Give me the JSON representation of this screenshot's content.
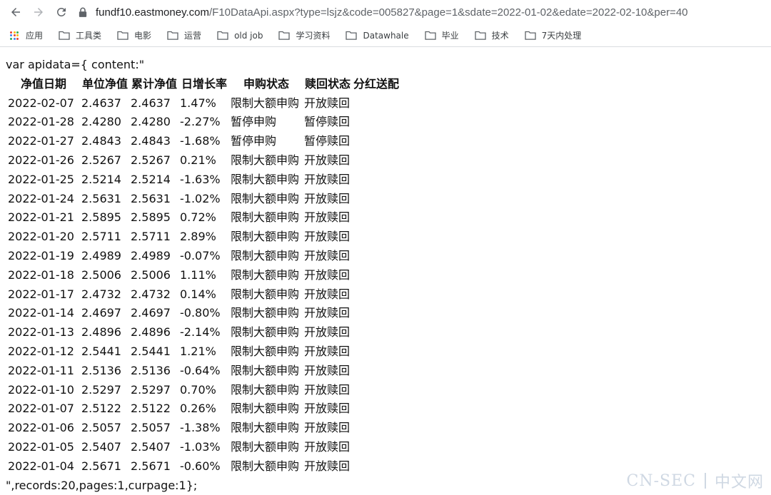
{
  "browser": {
    "url_host": "fundf10.eastmoney.com",
    "url_rest": "/F10DataApi.aspx?type=lsjz&code=005827&page=1&sdate=2022-01-02&edate=2022-02-10&per=40"
  },
  "bookmarks": [
    {
      "label": "应用",
      "icon": "apps-grid-icon"
    },
    {
      "label": "工具类",
      "icon": "folder-icon"
    },
    {
      "label": "电影",
      "icon": "folder-icon"
    },
    {
      "label": "运营",
      "icon": "folder-icon"
    },
    {
      "label": "old job",
      "icon": "folder-icon"
    },
    {
      "label": "学习资料",
      "icon": "folder-icon"
    },
    {
      "label": "Datawhale",
      "icon": "folder-icon"
    },
    {
      "label": "毕业",
      "icon": "folder-icon"
    },
    {
      "label": "技术",
      "icon": "folder-icon"
    },
    {
      "label": "7天内处理",
      "icon": "folder-icon"
    }
  ],
  "content": {
    "prefix": "var apidata={ content:\"",
    "suffix": "\",records:20,pages:1,curpage:1};",
    "headers": [
      "净值日期",
      "单位净值",
      "累计净值",
      "日增长率",
      "申购状态",
      "赎回状态",
      "分红送配"
    ],
    "rows": [
      [
        "2022-02-07",
        "2.4637",
        "2.4637",
        "1.47%",
        "限制大额申购",
        "开放赎回",
        ""
      ],
      [
        "2022-01-28",
        "2.4280",
        "2.4280",
        "-2.27%",
        "暂停申购",
        "暂停赎回",
        ""
      ],
      [
        "2022-01-27",
        "2.4843",
        "2.4843",
        "-1.68%",
        "暂停申购",
        "暂停赎回",
        ""
      ],
      [
        "2022-01-26",
        "2.5267",
        "2.5267",
        "0.21%",
        "限制大额申购",
        "开放赎回",
        ""
      ],
      [
        "2022-01-25",
        "2.5214",
        "2.5214",
        "-1.63%",
        "限制大额申购",
        "开放赎回",
        ""
      ],
      [
        "2022-01-24",
        "2.5631",
        "2.5631",
        "-1.02%",
        "限制大额申购",
        "开放赎回",
        ""
      ],
      [
        "2022-01-21",
        "2.5895",
        "2.5895",
        "0.72%",
        "限制大额申购",
        "开放赎回",
        ""
      ],
      [
        "2022-01-20",
        "2.5711",
        "2.5711",
        "2.89%",
        "限制大额申购",
        "开放赎回",
        ""
      ],
      [
        "2022-01-19",
        "2.4989",
        "2.4989",
        "-0.07%",
        "限制大额申购",
        "开放赎回",
        ""
      ],
      [
        "2022-01-18",
        "2.5006",
        "2.5006",
        "1.11%",
        "限制大额申购",
        "开放赎回",
        ""
      ],
      [
        "2022-01-17",
        "2.4732",
        "2.4732",
        "0.14%",
        "限制大额申购",
        "开放赎回",
        ""
      ],
      [
        "2022-01-14",
        "2.4697",
        "2.4697",
        "-0.80%",
        "限制大额申购",
        "开放赎回",
        ""
      ],
      [
        "2022-01-13",
        "2.4896",
        "2.4896",
        "-2.14%",
        "限制大额申购",
        "开放赎回",
        ""
      ],
      [
        "2022-01-12",
        "2.5441",
        "2.5441",
        "1.21%",
        "限制大额申购",
        "开放赎回",
        ""
      ],
      [
        "2022-01-11",
        "2.5136",
        "2.5136",
        "-0.64%",
        "限制大额申购",
        "开放赎回",
        ""
      ],
      [
        "2022-01-10",
        "2.5297",
        "2.5297",
        "0.70%",
        "限制大额申购",
        "开放赎回",
        ""
      ],
      [
        "2022-01-07",
        "2.5122",
        "2.5122",
        "0.26%",
        "限制大额申购",
        "开放赎回",
        ""
      ],
      [
        "2022-01-06",
        "2.5057",
        "2.5057",
        "-1.38%",
        "限制大额申购",
        "开放赎回",
        ""
      ],
      [
        "2022-01-05",
        "2.5407",
        "2.5407",
        "-1.03%",
        "限制大额申购",
        "开放赎回",
        ""
      ],
      [
        "2022-01-04",
        "2.5671",
        "2.5671",
        "-0.60%",
        "限制大额申购",
        "开放赎回",
        ""
      ]
    ]
  },
  "watermark": {
    "left": "CN-SEC",
    "right": "中文网"
  },
  "colors": {
    "apps_dots": [
      "#ea4335",
      "#fbbc04",
      "#34a853",
      "#4285f4",
      "#ea4335",
      "#fbbc04",
      "#34a853",
      "#4285f4",
      "#ea4335"
    ],
    "folder": "#5f6368"
  }
}
